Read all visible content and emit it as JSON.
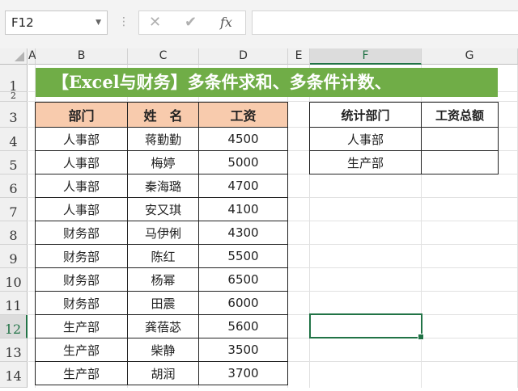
{
  "formula_bar": {
    "name_box": "F12",
    "cancel_icon": "✕",
    "enter_icon": "✔",
    "fx_icon": "fx",
    "formula": ""
  },
  "columns": [
    "A",
    "B",
    "C",
    "D",
    "E",
    "F",
    "G"
  ],
  "selected_column": "F",
  "rows": [
    "1",
    "2",
    "3",
    "4",
    "5",
    "6",
    "7",
    "8",
    "9",
    "10",
    "11",
    "12",
    "13",
    "14"
  ],
  "selected_row": "12",
  "banner_text": "【Excel与财务】多条件求和、多条件计数、",
  "main_table": {
    "headers": [
      "部门",
      "姓　名",
      "工资"
    ],
    "rows": [
      [
        "人事部",
        "蒋勤勤",
        "4500"
      ],
      [
        "人事部",
        "梅婷",
        "5000"
      ],
      [
        "人事部",
        "秦海璐",
        "4700"
      ],
      [
        "人事部",
        "安又琪",
        "4100"
      ],
      [
        "财务部",
        "马伊俐",
        "4300"
      ],
      [
        "财务部",
        "陈红",
        "5500"
      ],
      [
        "财务部",
        "杨幂",
        "6500"
      ],
      [
        "财务部",
        "田震",
        "6000"
      ],
      [
        "生产部",
        "龚蓓苾",
        "5600"
      ],
      [
        "生产部",
        "柴静",
        "3500"
      ],
      [
        "生产部",
        "胡润",
        "3700"
      ]
    ]
  },
  "summary_table": {
    "headers": [
      "统计部门",
      "工资总额"
    ],
    "rows": [
      [
        "人事部",
        ""
      ],
      [
        "生产部",
        ""
      ]
    ]
  },
  "colors": {
    "banner": "#70ad47",
    "header_fill": "#f8cbad",
    "selection": "#217346"
  }
}
